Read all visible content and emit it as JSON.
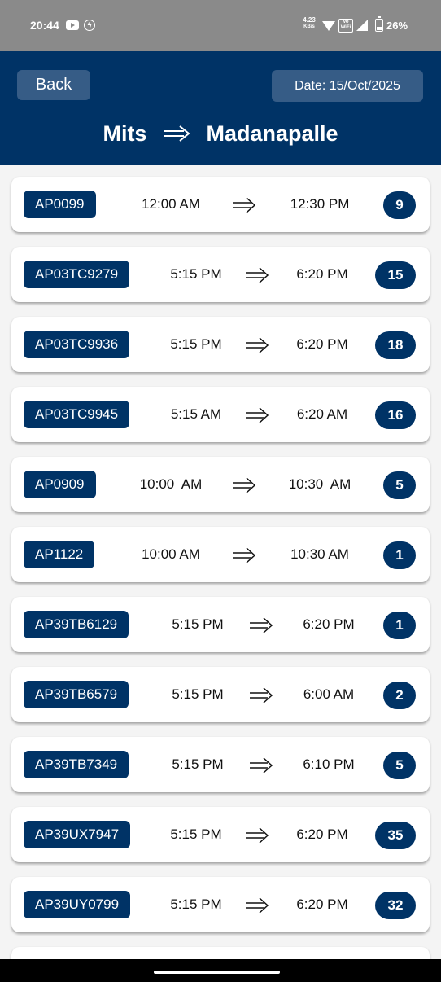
{
  "status_bar": {
    "time": "20:44",
    "net_speed_value": "4.23",
    "net_speed_unit": "KB/s",
    "vowifi_top": "Vo",
    "vowifi_bottom": "WiFi",
    "battery_percent": "26%",
    "icons": [
      "youtube-icon",
      "data-saver-icon",
      "wifi-icon",
      "vowifi-icon",
      "signal-icon",
      "battery-icon"
    ]
  },
  "header": {
    "back_label": "Back",
    "date_label": "Date: 15/Oct/2025",
    "route_from": "Mits",
    "route_to": "Madanapalle",
    "background_color": "#003366",
    "button_color": "#365c86"
  },
  "buses": [
    {
      "id": "AP0099",
      "departure": "12:00 AM",
      "arrival": "12:30 PM",
      "seats": "9"
    },
    {
      "id": "AP03TC9279",
      "departure": "5:15 PM",
      "arrival": "6:20 PM",
      "seats": "15"
    },
    {
      "id": "AP03TC9936",
      "departure": "5:15 PM",
      "arrival": "6:20 PM",
      "seats": "18"
    },
    {
      "id": "AP03TC9945",
      "departure": "5:15 AM",
      "arrival": "6:20 AM",
      "seats": "16"
    },
    {
      "id": "AP0909",
      "departure": "10:00  AM",
      "arrival": "10:30  AM",
      "seats": "5"
    },
    {
      "id": "AP1122",
      "departure": "10:00 AM",
      "arrival": "10:30 AM",
      "seats": "1"
    },
    {
      "id": "AP39TB6129",
      "departure": "5:15 PM",
      "arrival": "6:20 PM",
      "seats": "1"
    },
    {
      "id": "AP39TB6579",
      "departure": "5:15 PM",
      "arrival": "6:00 AM",
      "seats": "2"
    },
    {
      "id": "AP39TB7349",
      "departure": "5:15 PM",
      "arrival": "6:10 PM",
      "seats": "5"
    },
    {
      "id": "AP39UX7947",
      "departure": "5:15 PM",
      "arrival": "6:20 PM",
      "seats": "35"
    },
    {
      "id": "AP39UY0799",
      "departure": "5:15 PM",
      "arrival": "6:20 PM",
      "seats": "32"
    }
  ],
  "colors": {
    "accent": "#003366",
    "card_background": "#ffffff",
    "list_background": "#f4f4f4"
  }
}
